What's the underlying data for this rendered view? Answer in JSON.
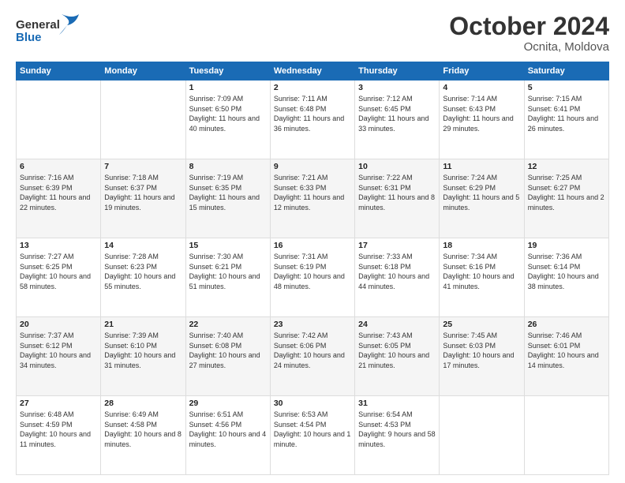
{
  "header": {
    "logo_general": "General",
    "logo_blue": "Blue",
    "month_year": "October 2024",
    "location": "Ocnita, Moldova"
  },
  "weekdays": [
    "Sunday",
    "Monday",
    "Tuesday",
    "Wednesday",
    "Thursday",
    "Friday",
    "Saturday"
  ],
  "weeks": [
    [
      {
        "day": "",
        "sunrise": "",
        "sunset": "",
        "daylight": ""
      },
      {
        "day": "",
        "sunrise": "",
        "sunset": "",
        "daylight": ""
      },
      {
        "day": "1",
        "sunrise": "Sunrise: 7:09 AM",
        "sunset": "Sunset: 6:50 PM",
        "daylight": "Daylight: 11 hours and 40 minutes."
      },
      {
        "day": "2",
        "sunrise": "Sunrise: 7:11 AM",
        "sunset": "Sunset: 6:48 PM",
        "daylight": "Daylight: 11 hours and 36 minutes."
      },
      {
        "day": "3",
        "sunrise": "Sunrise: 7:12 AM",
        "sunset": "Sunset: 6:45 PM",
        "daylight": "Daylight: 11 hours and 33 minutes."
      },
      {
        "day": "4",
        "sunrise": "Sunrise: 7:14 AM",
        "sunset": "Sunset: 6:43 PM",
        "daylight": "Daylight: 11 hours and 29 minutes."
      },
      {
        "day": "5",
        "sunrise": "Sunrise: 7:15 AM",
        "sunset": "Sunset: 6:41 PM",
        "daylight": "Daylight: 11 hours and 26 minutes."
      }
    ],
    [
      {
        "day": "6",
        "sunrise": "Sunrise: 7:16 AM",
        "sunset": "Sunset: 6:39 PM",
        "daylight": "Daylight: 11 hours and 22 minutes."
      },
      {
        "day": "7",
        "sunrise": "Sunrise: 7:18 AM",
        "sunset": "Sunset: 6:37 PM",
        "daylight": "Daylight: 11 hours and 19 minutes."
      },
      {
        "day": "8",
        "sunrise": "Sunrise: 7:19 AM",
        "sunset": "Sunset: 6:35 PM",
        "daylight": "Daylight: 11 hours and 15 minutes."
      },
      {
        "day": "9",
        "sunrise": "Sunrise: 7:21 AM",
        "sunset": "Sunset: 6:33 PM",
        "daylight": "Daylight: 11 hours and 12 minutes."
      },
      {
        "day": "10",
        "sunrise": "Sunrise: 7:22 AM",
        "sunset": "Sunset: 6:31 PM",
        "daylight": "Daylight: 11 hours and 8 minutes."
      },
      {
        "day": "11",
        "sunrise": "Sunrise: 7:24 AM",
        "sunset": "Sunset: 6:29 PM",
        "daylight": "Daylight: 11 hours and 5 minutes."
      },
      {
        "day": "12",
        "sunrise": "Sunrise: 7:25 AM",
        "sunset": "Sunset: 6:27 PM",
        "daylight": "Daylight: 11 hours and 2 minutes."
      }
    ],
    [
      {
        "day": "13",
        "sunrise": "Sunrise: 7:27 AM",
        "sunset": "Sunset: 6:25 PM",
        "daylight": "Daylight: 10 hours and 58 minutes."
      },
      {
        "day": "14",
        "sunrise": "Sunrise: 7:28 AM",
        "sunset": "Sunset: 6:23 PM",
        "daylight": "Daylight: 10 hours and 55 minutes."
      },
      {
        "day": "15",
        "sunrise": "Sunrise: 7:30 AM",
        "sunset": "Sunset: 6:21 PM",
        "daylight": "Daylight: 10 hours and 51 minutes."
      },
      {
        "day": "16",
        "sunrise": "Sunrise: 7:31 AM",
        "sunset": "Sunset: 6:19 PM",
        "daylight": "Daylight: 10 hours and 48 minutes."
      },
      {
        "day": "17",
        "sunrise": "Sunrise: 7:33 AM",
        "sunset": "Sunset: 6:18 PM",
        "daylight": "Daylight: 10 hours and 44 minutes."
      },
      {
        "day": "18",
        "sunrise": "Sunrise: 7:34 AM",
        "sunset": "Sunset: 6:16 PM",
        "daylight": "Daylight: 10 hours and 41 minutes."
      },
      {
        "day": "19",
        "sunrise": "Sunrise: 7:36 AM",
        "sunset": "Sunset: 6:14 PM",
        "daylight": "Daylight: 10 hours and 38 minutes."
      }
    ],
    [
      {
        "day": "20",
        "sunrise": "Sunrise: 7:37 AM",
        "sunset": "Sunset: 6:12 PM",
        "daylight": "Daylight: 10 hours and 34 minutes."
      },
      {
        "day": "21",
        "sunrise": "Sunrise: 7:39 AM",
        "sunset": "Sunset: 6:10 PM",
        "daylight": "Daylight: 10 hours and 31 minutes."
      },
      {
        "day": "22",
        "sunrise": "Sunrise: 7:40 AM",
        "sunset": "Sunset: 6:08 PM",
        "daylight": "Daylight: 10 hours and 27 minutes."
      },
      {
        "day": "23",
        "sunrise": "Sunrise: 7:42 AM",
        "sunset": "Sunset: 6:06 PM",
        "daylight": "Daylight: 10 hours and 24 minutes."
      },
      {
        "day": "24",
        "sunrise": "Sunrise: 7:43 AM",
        "sunset": "Sunset: 6:05 PM",
        "daylight": "Daylight: 10 hours and 21 minutes."
      },
      {
        "day": "25",
        "sunrise": "Sunrise: 7:45 AM",
        "sunset": "Sunset: 6:03 PM",
        "daylight": "Daylight: 10 hours and 17 minutes."
      },
      {
        "day": "26",
        "sunrise": "Sunrise: 7:46 AM",
        "sunset": "Sunset: 6:01 PM",
        "daylight": "Daylight: 10 hours and 14 minutes."
      }
    ],
    [
      {
        "day": "27",
        "sunrise": "Sunrise: 6:48 AM",
        "sunset": "Sunset: 4:59 PM",
        "daylight": "Daylight: 10 hours and 11 minutes."
      },
      {
        "day": "28",
        "sunrise": "Sunrise: 6:49 AM",
        "sunset": "Sunset: 4:58 PM",
        "daylight": "Daylight: 10 hours and 8 minutes."
      },
      {
        "day": "29",
        "sunrise": "Sunrise: 6:51 AM",
        "sunset": "Sunset: 4:56 PM",
        "daylight": "Daylight: 10 hours and 4 minutes."
      },
      {
        "day": "30",
        "sunrise": "Sunrise: 6:53 AM",
        "sunset": "Sunset: 4:54 PM",
        "daylight": "Daylight: 10 hours and 1 minute."
      },
      {
        "day": "31",
        "sunrise": "Sunrise: 6:54 AM",
        "sunset": "Sunset: 4:53 PM",
        "daylight": "Daylight: 9 hours and 58 minutes."
      },
      {
        "day": "",
        "sunrise": "",
        "sunset": "",
        "daylight": ""
      },
      {
        "day": "",
        "sunrise": "",
        "sunset": "",
        "daylight": ""
      }
    ]
  ]
}
